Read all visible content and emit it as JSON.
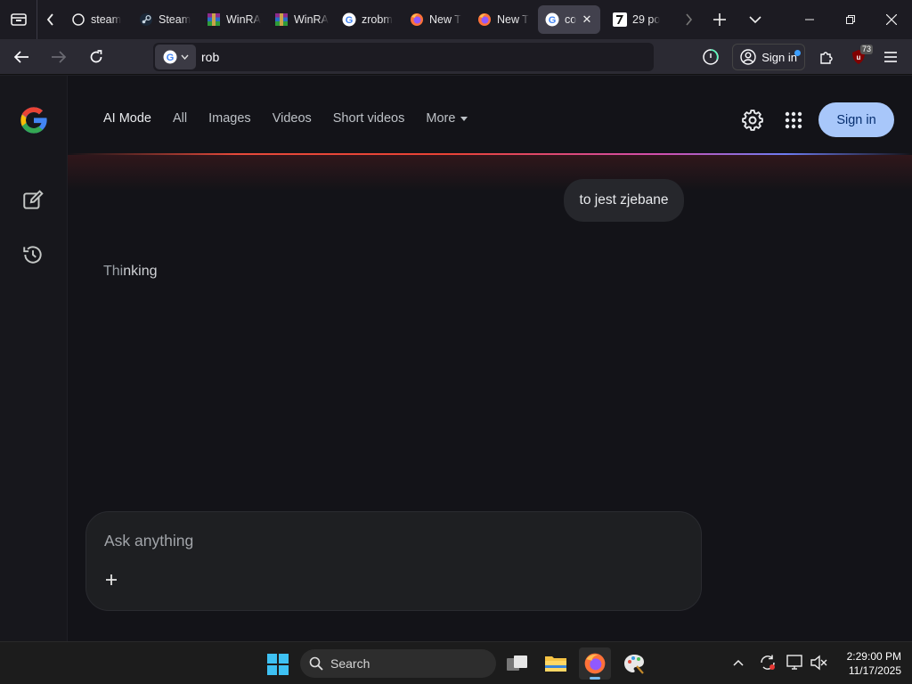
{
  "browser": {
    "tabs": [
      {
        "title": "steam",
        "icon": "steam-icon",
        "active": false
      },
      {
        "title": "Steam",
        "icon": "steam-icon",
        "active": false
      },
      {
        "title": "WinRA",
        "icon": "winrar-icon",
        "active": false
      },
      {
        "title": "WinRA",
        "icon": "winrar-icon",
        "active": false
      },
      {
        "title": "zrobm",
        "icon": "google-icon",
        "active": false
      },
      {
        "title": "New T",
        "icon": "firefox-icon",
        "active": false
      },
      {
        "title": "New T",
        "icon": "firefox-icon",
        "active": false
      },
      {
        "title": "co",
        "icon": "google-icon",
        "active": true
      },
      {
        "title": "29 po",
        "icon": "site-7-icon",
        "active": false
      }
    ],
    "url": "rob",
    "signin_label": "Sign in",
    "extension_badge": "73"
  },
  "page": {
    "nav": {
      "items": [
        "AI Mode",
        "All",
        "Images",
        "Videos",
        "Short videos",
        "More"
      ],
      "active_index": 0
    },
    "signin_button": "Sign in",
    "user_message": "to jest zjebane",
    "thinking_text_a": "Thi",
    "thinking_text_b": "nking",
    "ask_placeholder": "Ask anything"
  },
  "taskbar": {
    "search_label": "Search",
    "time": "2:29:00 PM",
    "date": "11/17/2025"
  },
  "colors": {
    "accent": "#a8c7fa",
    "page_bg": "#131318",
    "glow_red": "#ea4335",
    "glow_blue": "#6e7cf2"
  }
}
